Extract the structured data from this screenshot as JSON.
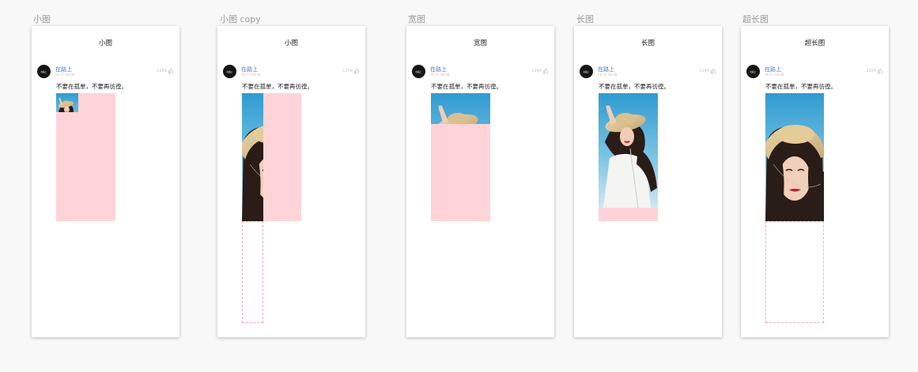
{
  "canvas_background": "#f8f8f8",
  "accent_colors": {
    "placeholder_pink": "#ffd4d8",
    "dashed_outline": "#f3a7b4",
    "username_blue": "#4a78c0",
    "muted_gray": "#c4c4c4"
  },
  "artboards": [
    {
      "label": "小图",
      "nav_title": "小图",
      "post": {
        "avatar_text": "在路上",
        "user_name": "在路上",
        "time": "06-10 08:48",
        "like_count": "1254",
        "like_icon": "thumb-up-icon",
        "text": "不要在孤单，不要再彷徨。"
      }
    },
    {
      "label": "小图 copy",
      "nav_title": "小图",
      "post": {
        "avatar_text": "在路上",
        "user_name": "在路上",
        "time": "06-10 08:48",
        "like_count": "1254",
        "like_icon": "thumb-up-icon",
        "text": "不要在孤单，不要再彷徨。"
      }
    },
    {
      "label": "宽图",
      "nav_title": "宽图",
      "post": {
        "avatar_text": "在路上",
        "user_name": "在路上",
        "time": "06-10 08:48",
        "like_count": "1254",
        "like_icon": "thumb-up-icon",
        "text": "不要在孤单，不要再彷徨。"
      }
    },
    {
      "label": "长图",
      "nav_title": "长图",
      "post": {
        "avatar_text": "在路上",
        "user_name": "在路上",
        "time": "06-10 08:48",
        "like_count": "1254",
        "like_icon": "thumb-up-icon",
        "text": "不要在孤单，不要再彷徨。"
      }
    },
    {
      "label": "超长图",
      "nav_title": "超长图",
      "post": {
        "avatar_text": "在路上",
        "user_name": "在路上",
        "time": "06-10 08:48",
        "like_count": "1254",
        "like_icon": "thumb-up-icon",
        "text": "不要在孤单，不要再彷徨。"
      }
    }
  ]
}
